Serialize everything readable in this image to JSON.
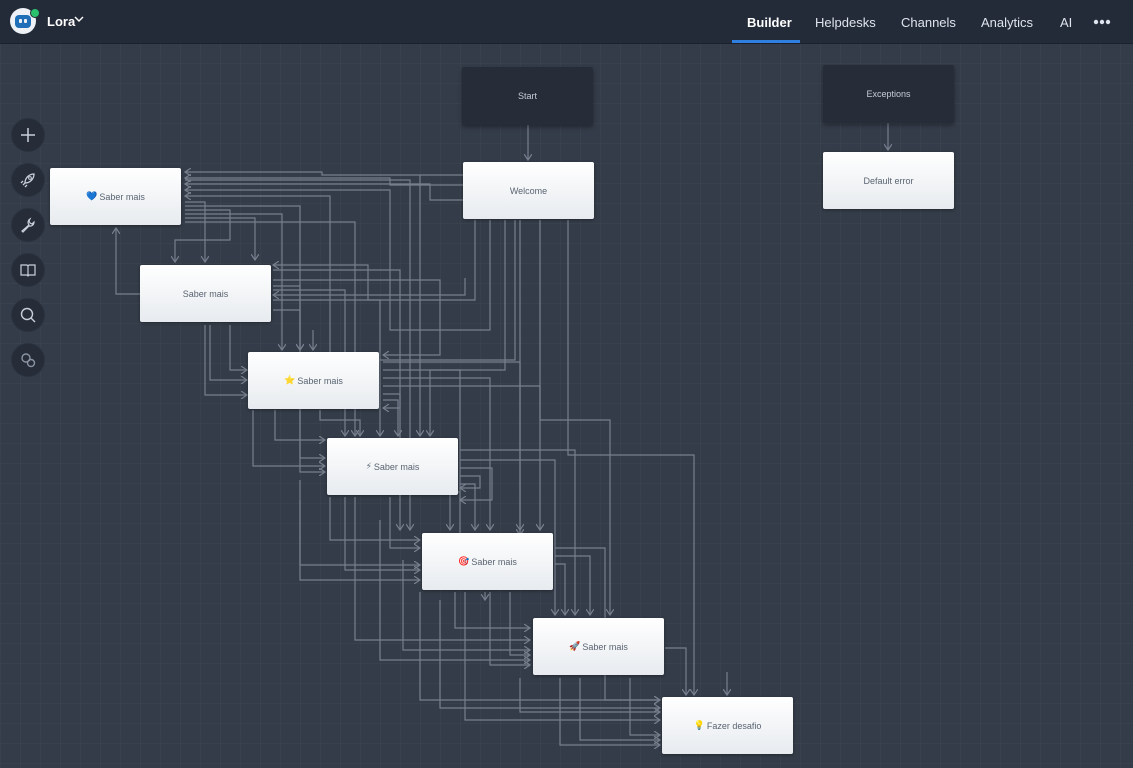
{
  "bot": {
    "name": "Lora"
  },
  "nav": {
    "tabs": [
      {
        "label": "Builder",
        "active": true
      },
      {
        "label": "Helpdesks"
      },
      {
        "label": "Channels"
      },
      {
        "label": "Analytics"
      },
      {
        "label": "AI"
      }
    ]
  },
  "toolbar": {
    "tools": [
      {
        "icon": "plus-icon"
      },
      {
        "icon": "rocket-icon"
      },
      {
        "icon": "wrench-icon"
      },
      {
        "icon": "book-icon"
      },
      {
        "icon": "search-icon"
      },
      {
        "icon": "settings-cog-icon"
      }
    ]
  },
  "flow": {
    "start": "Start",
    "exceptions": "Exceptions",
    "welcome": "Welcome",
    "default_error": "Default error",
    "n1": {
      "emoji": "💙",
      "label": "Saber mais"
    },
    "n2": {
      "label": "Saber mais"
    },
    "n3": {
      "emoji": "⭐",
      "label": "Saber mais"
    },
    "n4": {
      "emoji": "⚡",
      "label": "Saber mais"
    },
    "n5": {
      "emoji": "🎯",
      "label": "Saber mais"
    },
    "n6": {
      "emoji": "🚀",
      "label": "Saber mais"
    },
    "n7": {
      "emoji": "💡",
      "label": "Fazer desafio"
    }
  },
  "colors": {
    "accent": "#2f7fe0",
    "topbar": "#242b38",
    "canvas": "#343c49",
    "edge": "#7f8796",
    "online": "#29c06e"
  }
}
